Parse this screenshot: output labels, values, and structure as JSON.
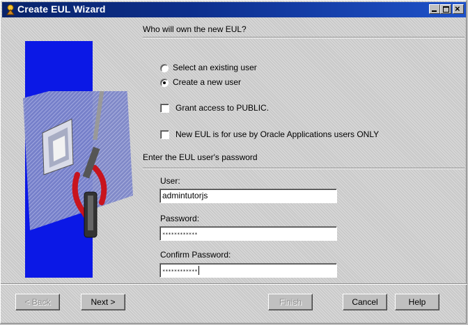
{
  "window": {
    "title": "Create EUL Wizard"
  },
  "owner_section": {
    "heading": "Who will own the new EUL?"
  },
  "radio_options": [
    {
      "label": "Select an existing user",
      "selected": false
    },
    {
      "label": "Create a new user",
      "selected": true
    }
  ],
  "checkboxes": [
    {
      "label": "Grant access to PUBLIC.",
      "checked": false
    },
    {
      "label": "New EUL is for use by Oracle Applications users ONLY",
      "checked": false
    }
  ],
  "password_section": {
    "heading": "Enter the EUL user's password"
  },
  "fields": {
    "user": {
      "label": "User:",
      "value": "admintutorjs"
    },
    "password": {
      "label": "Password:",
      "value": "************"
    },
    "confirm": {
      "label": "Confirm Password:",
      "value": "************"
    }
  },
  "buttons": {
    "back": "< Back",
    "next": "Next >",
    "finish": "Finish",
    "cancel": "Cancel",
    "help": "Help"
  },
  "colors": {
    "titlebar": "#0a246a",
    "art_panel": "#0b18e6"
  }
}
